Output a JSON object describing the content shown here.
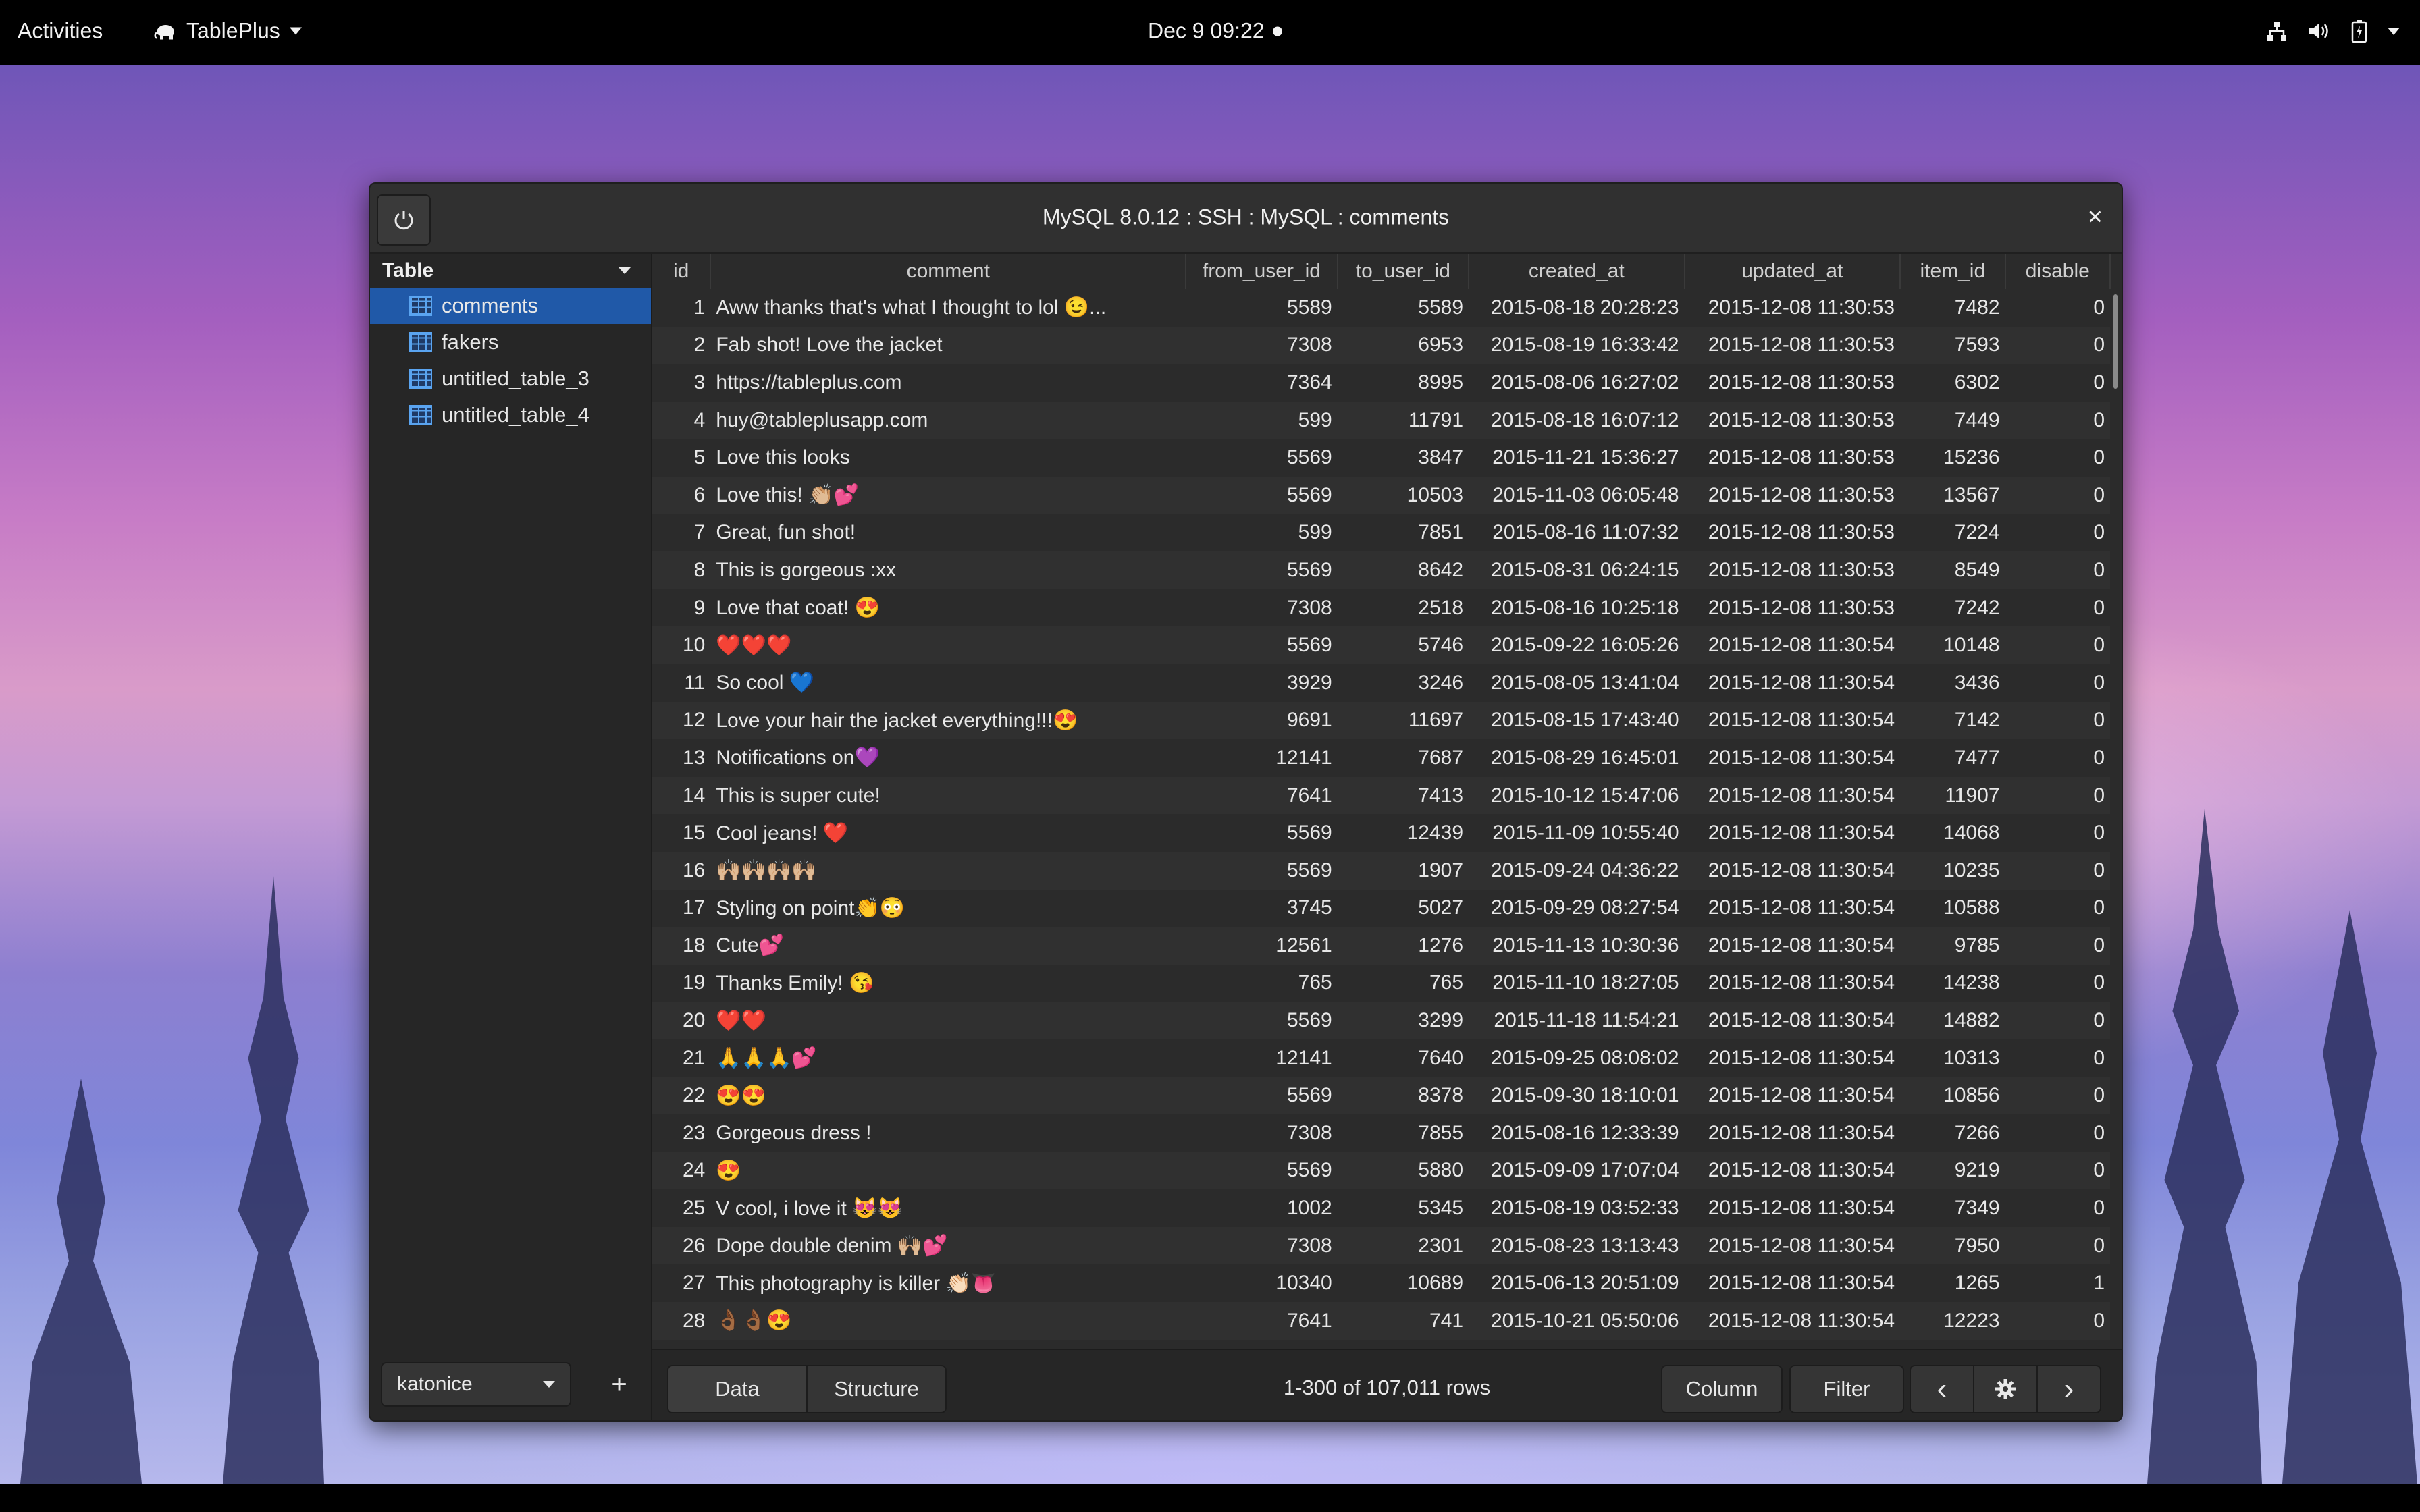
{
  "topbar": {
    "activities": "Activities",
    "app_name": "TablePlus",
    "clock": "Dec 9  09:22"
  },
  "window": {
    "title": "MySQL 8.0.12 : SSH : MySQL : comments",
    "close": "×"
  },
  "sidebar": {
    "header": "Table",
    "items": [
      {
        "label": "comments",
        "selected": true
      },
      {
        "label": "fakers"
      },
      {
        "label": "untitled_table_3"
      },
      {
        "label": "untitled_table_4"
      }
    ],
    "database": "katonice",
    "add": "+"
  },
  "grid": {
    "columns": [
      "id",
      "comment",
      "from_user_id",
      "to_user_id",
      "created_at",
      "updated_at",
      "item_id",
      "disable"
    ],
    "rows": [
      [
        "1",
        "Aww thanks that's what I thought to lol 😉...",
        "5589",
        "5589",
        "2015-08-18 20:28:23",
        "2015-12-08 11:30:53",
        "7482",
        "0"
      ],
      [
        "2",
        "Fab shot! Love the jacket",
        "7308",
        "6953",
        "2015-08-19 16:33:42",
        "2015-12-08 11:30:53",
        "7593",
        "0"
      ],
      [
        "3",
        "https://tableplus.com",
        "7364",
        "8995",
        "2015-08-06 16:27:02",
        "2015-12-08 11:30:53",
        "6302",
        "0"
      ],
      [
        "4",
        "huy@tableplusapp.com",
        "599",
        "11791",
        "2015-08-18 16:07:12",
        "2015-12-08 11:30:53",
        "7449",
        "0"
      ],
      [
        "5",
        "Love this looks",
        "5569",
        "3847",
        "2015-11-21 15:36:27",
        "2015-12-08 11:30:53",
        "15236",
        "0"
      ],
      [
        "6",
        "Love this! 👏🏼💕",
        "5569",
        "10503",
        "2015-11-03 06:05:48",
        "2015-12-08 11:30:53",
        "13567",
        "0"
      ],
      [
        "7",
        "Great, fun shot!",
        "599",
        "7851",
        "2015-08-16 11:07:32",
        "2015-12-08 11:30:53",
        "7224",
        "0"
      ],
      [
        "8",
        "This is gorgeous :xx",
        "5569",
        "8642",
        "2015-08-31 06:24:15",
        "2015-12-08 11:30:53",
        "8549",
        "0"
      ],
      [
        "9",
        "Love that coat! 😍",
        "7308",
        "2518",
        "2015-08-16 10:25:18",
        "2015-12-08 11:30:53",
        "7242",
        "0"
      ],
      [
        "10",
        "❤️❤️❤️",
        "5569",
        "5746",
        "2015-09-22 16:05:26",
        "2015-12-08 11:30:54",
        "10148",
        "0"
      ],
      [
        "11",
        "So cool 💙",
        "3929",
        "3246",
        "2015-08-05 13:41:04",
        "2015-12-08 11:30:54",
        "3436",
        "0"
      ],
      [
        "12",
        "Love your hair the jacket everything!!!😍",
        "9691",
        "11697",
        "2015-08-15 17:43:40",
        "2015-12-08 11:30:54",
        "7142",
        "0"
      ],
      [
        "13",
        "Notifications on💜",
        "12141",
        "7687",
        "2015-08-29 16:45:01",
        "2015-12-08 11:30:54",
        "7477",
        "0"
      ],
      [
        "14",
        "This is super cute!",
        "7641",
        "7413",
        "2015-10-12 15:47:06",
        "2015-12-08 11:30:54",
        "11907",
        "0"
      ],
      [
        "15",
        "Cool jeans! ❤️",
        "5569",
        "12439",
        "2015-11-09 10:55:40",
        "2015-12-08 11:30:54",
        "14068",
        "0"
      ],
      [
        "16",
        "🙌🏼🙌🏼🙌🏼🙌🏼",
        "5569",
        "1907",
        "2015-09-24 04:36:22",
        "2015-12-08 11:30:54",
        "10235",
        "0"
      ],
      [
        "17",
        "Styling on point👏😳",
        "3745",
        "5027",
        "2015-09-29 08:27:54",
        "2015-12-08 11:30:54",
        "10588",
        "0"
      ],
      [
        "18",
        "Cute💕",
        "12561",
        "1276",
        "2015-11-13 10:30:36",
        "2015-12-08 11:30:54",
        "9785",
        "0"
      ],
      [
        "19",
        "Thanks Emily! 😘",
        "765",
        "765",
        "2015-11-10 18:27:05",
        "2015-12-08 11:30:54",
        "14238",
        "0"
      ],
      [
        "20",
        "❤️❤️",
        "5569",
        "3299",
        "2015-11-18 11:54:21",
        "2015-12-08 11:30:54",
        "14882",
        "0"
      ],
      [
        "21",
        "🙏🙏🙏💕",
        "12141",
        "7640",
        "2015-09-25 08:08:02",
        "2015-12-08 11:30:54",
        "10313",
        "0"
      ],
      [
        "22",
        "😍😍",
        "5569",
        "8378",
        "2015-09-30 18:10:01",
        "2015-12-08 11:30:54",
        "10856",
        "0"
      ],
      [
        "23",
        "Gorgeous dress !",
        "7308",
        "7855",
        "2015-08-16 12:33:39",
        "2015-12-08 11:30:54",
        "7266",
        "0"
      ],
      [
        "24",
        "😍",
        "5569",
        "5880",
        "2015-09-09 17:07:04",
        "2015-12-08 11:30:54",
        "9219",
        "0"
      ],
      [
        "25",
        "V cool, i love it 😻😻",
        "1002",
        "5345",
        "2015-08-19 03:52:33",
        "2015-12-08 11:30:54",
        "7349",
        "0"
      ],
      [
        "26",
        "Dope double denim 🙌🏼💕",
        "7308",
        "2301",
        "2015-08-23 13:13:43",
        "2015-12-08 11:30:54",
        "7950",
        "0"
      ],
      [
        "27",
        "This photography is killer 👏🏻👅",
        "10340",
        "10689",
        "2015-06-13 20:51:09",
        "2015-12-08 11:30:54",
        "1265",
        "1"
      ],
      [
        "28",
        "👌🏾👌🏾😍",
        "7641",
        "741",
        "2015-10-21 05:50:06",
        "2015-12-08 11:30:54",
        "12223",
        "0"
      ]
    ]
  },
  "toolbar": {
    "data_tab": "Data",
    "structure_tab": "Structure",
    "row_count": "1-300 of 107,011 rows",
    "column_button": "Column",
    "filter_button": "Filter",
    "prev": "‹",
    "next": "›"
  },
  "colors": {
    "selection": "#2059a8",
    "table_icon": "#5aa4f0"
  }
}
